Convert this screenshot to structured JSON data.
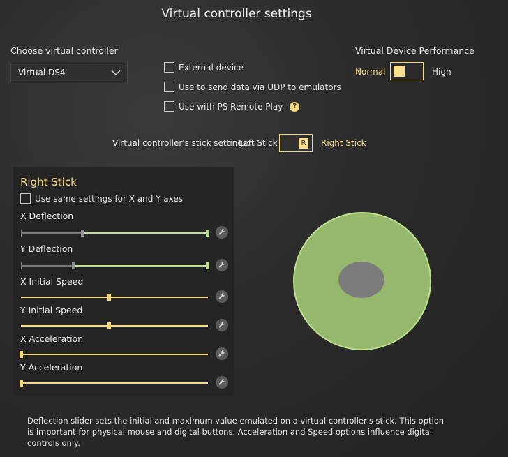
{
  "window": {
    "title": "Virtual controller settings"
  },
  "controller": {
    "choose_label": "Choose virtual controller",
    "selected": "Virtual DS4"
  },
  "options": {
    "external_device": "External device",
    "udp": "Use to send data via UDP to emulators",
    "remote_play": "Use with PS Remote Play"
  },
  "performance": {
    "title": "Virtual Device Performance",
    "normal": "Normal",
    "high": "High",
    "value": "Normal"
  },
  "stick_settings": {
    "label": "Virtual controller's stick settings:",
    "left": "Left Stick",
    "right": "Right Stick",
    "toggle_letter": "R",
    "selected": "Right Stick"
  },
  "panel": {
    "title": "Right Stick",
    "same_axes": "Use same settings for X and Y axes",
    "sliders": [
      {
        "label": "X Deflection",
        "type": "range",
        "low": 0.33,
        "high": 1.0
      },
      {
        "label": "Y Deflection",
        "type": "range",
        "low": 0.28,
        "high": 1.0
      },
      {
        "label": "X Initial Speed",
        "type": "single",
        "value": 0.47
      },
      {
        "label": "Y Initial Speed",
        "type": "single",
        "value": 0.47
      },
      {
        "label": "X Acceleration",
        "type": "single",
        "value": 0.0
      },
      {
        "label": "Y Acceleration",
        "type": "single",
        "value": 0.0
      }
    ]
  },
  "footer": {
    "text": "Deflection slider sets the initial and maximum value emulated on a virtual controller's stick. This option is important for physical mouse and digital buttons. Acceleration and Speed options influence digital controls only."
  },
  "colors": {
    "accent": "#f4d77a",
    "green": "#95b86c",
    "green_light": "#bfe08f",
    "track_gray": "#7a7a7a"
  }
}
